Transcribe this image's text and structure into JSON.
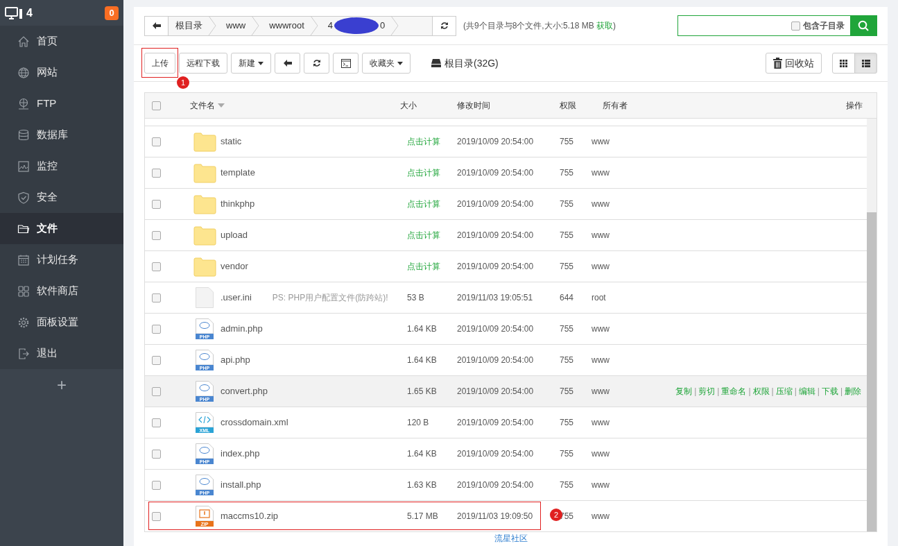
{
  "sidebar": {
    "title": "4",
    "badge": "0",
    "items": [
      {
        "label": "首页",
        "selected": false
      },
      {
        "label": "网站",
        "selected": false
      },
      {
        "label": "FTP",
        "selected": false
      },
      {
        "label": "数据库",
        "selected": false
      },
      {
        "label": "监控",
        "selected": false
      },
      {
        "label": "安全",
        "selected": false
      },
      {
        "label": "文件",
        "selected": true
      },
      {
        "label": "计划任务",
        "selected": false
      },
      {
        "label": "软件商店",
        "selected": false
      },
      {
        "label": "面板设置",
        "selected": false
      },
      {
        "label": "退出",
        "selected": false
      }
    ],
    "add": "+"
  },
  "breadcrumb": [
    {
      "label": "根目录"
    },
    {
      "label": "www"
    },
    {
      "label": "wwwroot"
    },
    {
      "label": "4",
      "tail": "0",
      "redacted": true
    }
  ],
  "summary": {
    "text": "(共9个目录与8个文件,大小:5.18 MB",
    "link": "获取",
    "close": ")"
  },
  "search": {
    "option": "包含子目录",
    "checked": false
  },
  "toolbar": {
    "buttons": [
      {
        "label": "上传",
        "kind": "text",
        "annotation": "1"
      },
      {
        "label": "远程下载",
        "kind": "text"
      },
      {
        "label": "新建",
        "kind": "dropdown"
      },
      {
        "kind": "back"
      },
      {
        "kind": "refresh"
      },
      {
        "kind": "terminal"
      },
      {
        "label": "收藏夹",
        "kind": "dropdown"
      }
    ],
    "disk": "根目录(32G)",
    "recycle": "回收站",
    "views": [
      {
        "kind": "grid",
        "selected": false
      },
      {
        "kind": "list",
        "selected": true
      }
    ]
  },
  "table": {
    "all_checked": false,
    "separator": "|",
    "columns": [
      "文件名",
      "大小",
      "修改时间",
      "权限",
      "所有者",
      "操作"
    ],
    "rows": [
      {
        "kind": "folder",
        "name": "static",
        "size": "点击计算",
        "time": "2019/10/09 20:54:00",
        "perm": "755",
        "owner": "www",
        "checked": false
      },
      {
        "kind": "folder",
        "name": "template",
        "size": "点击计算",
        "time": "2019/10/09 20:54:00",
        "perm": "755",
        "owner": "www",
        "checked": false
      },
      {
        "kind": "folder",
        "name": "thinkphp",
        "size": "点击计算",
        "time": "2019/10/09 20:54:00",
        "perm": "755",
        "owner": "www",
        "checked": false
      },
      {
        "kind": "folder",
        "name": "upload",
        "size": "点击计算",
        "time": "2019/10/09 20:54:00",
        "perm": "755",
        "owner": "www",
        "checked": false
      },
      {
        "kind": "folder",
        "name": "vendor",
        "size": "点击计算",
        "time": "2019/10/09 20:54:00",
        "perm": "755",
        "owner": "www",
        "checked": false
      },
      {
        "kind": "blank",
        "name": ".user.ini",
        "note": "PS: PHP用户配置文件(防跨站)!",
        "size": "53 B",
        "time": "2019/11/03 19:05:51",
        "perm": "644",
        "owner": "root",
        "checked": false
      },
      {
        "kind": "php",
        "icon_label": "PHP",
        "name": "admin.php",
        "size": "1.64 KB",
        "time": "2019/10/09 20:54:00",
        "perm": "755",
        "owner": "www",
        "checked": false
      },
      {
        "kind": "php",
        "icon_label": "PHP",
        "name": "api.php",
        "size": "1.64 KB",
        "time": "2019/10/09 20:54:00",
        "perm": "755",
        "owner": "www",
        "checked": false
      },
      {
        "kind": "php",
        "icon_label": "PHP",
        "name": "convert.php",
        "size": "1.65 KB",
        "time": "2019/10/09 20:54:00",
        "perm": "755",
        "owner": "www",
        "checked": false,
        "hovered": true,
        "actions": [
          "复制",
          "剪切",
          "重命名",
          "权限",
          "压缩",
          "编辑",
          "下载",
          "删除"
        ]
      },
      {
        "kind": "xml",
        "icon_label": "XML",
        "name": "crossdomain.xml",
        "size": "120 B",
        "time": "2019/10/09 20:54:00",
        "perm": "755",
        "owner": "www",
        "checked": false
      },
      {
        "kind": "php",
        "icon_label": "PHP",
        "name": "index.php",
        "size": "1.64 KB",
        "time": "2019/10/09 20:54:00",
        "perm": "755",
        "owner": "www",
        "checked": false
      },
      {
        "kind": "php",
        "icon_label": "PHP",
        "name": "install.php",
        "size": "1.63 KB",
        "time": "2019/10/09 20:54:00",
        "perm": "755",
        "owner": "www",
        "checked": false
      },
      {
        "kind": "zip",
        "icon_label": "ZIP",
        "name": "maccms10.zip",
        "size": "5.17 MB",
        "time": "2019/11/03 19:09:50",
        "perm": "755",
        "owner": "www",
        "checked": false,
        "annotation": "2"
      }
    ]
  },
  "footer": "流星社区"
}
